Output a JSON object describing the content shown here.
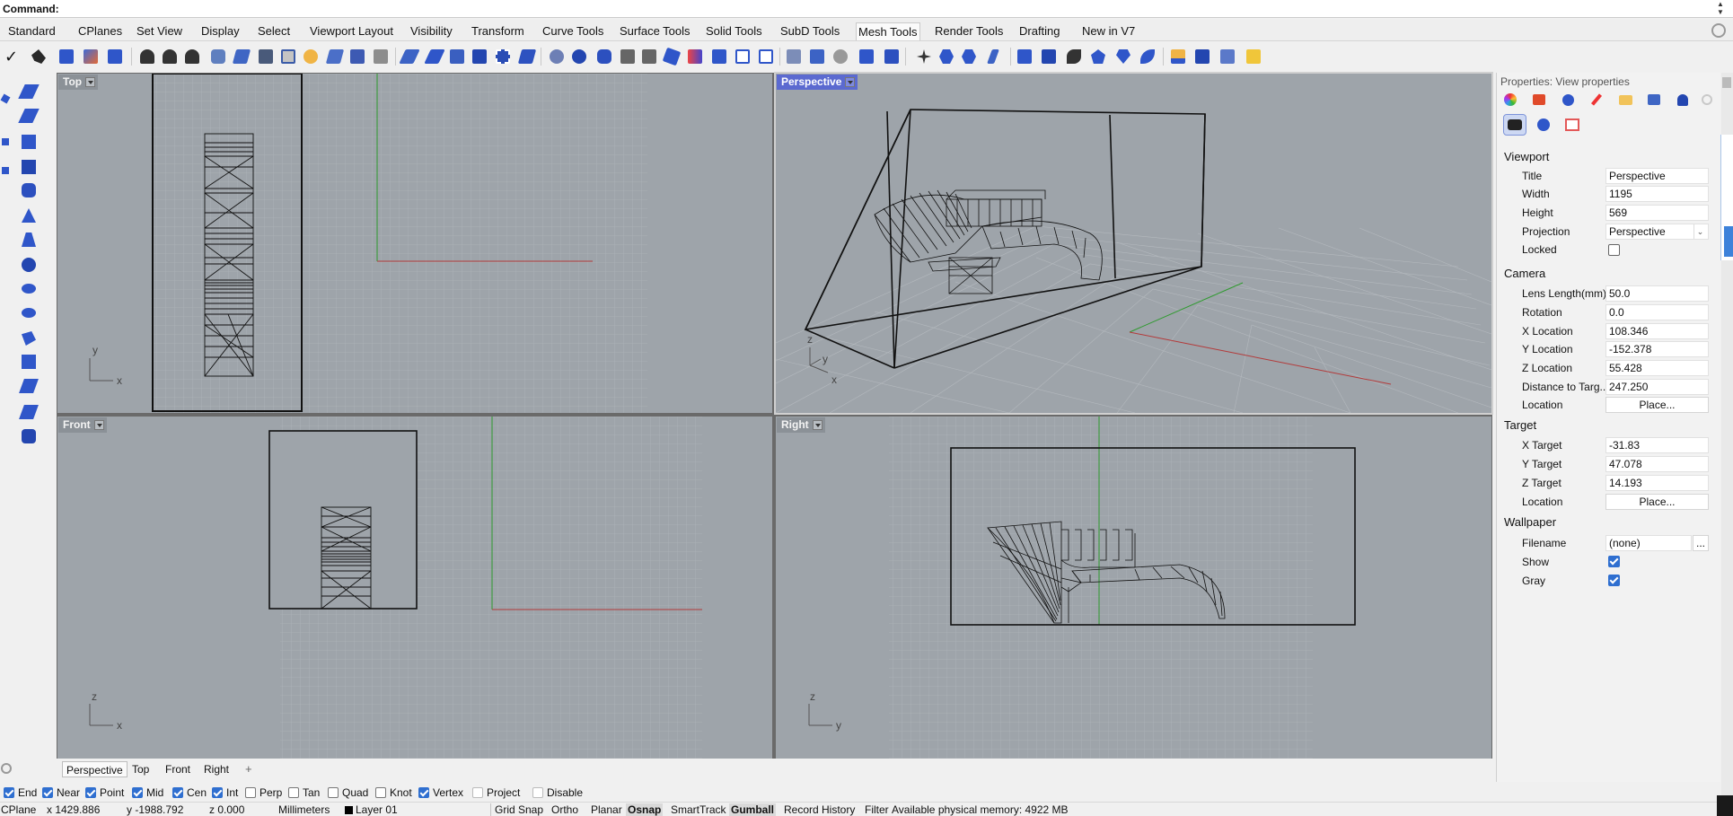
{
  "command": {
    "label": "Command:"
  },
  "tabs": [
    "Standard",
    "CPlanes",
    "Set View",
    "Display",
    "Select",
    "Viewport Layout",
    "Visibility",
    "Transform",
    "Curve Tools",
    "Surface Tools",
    "Solid Tools",
    "SubD Tools",
    "Mesh Tools",
    "Render Tools",
    "Drafting",
    "New in V7"
  ],
  "active_tab": "Mesh Tools",
  "viewports": {
    "top": {
      "title": "Top",
      "axis_a": "y",
      "axis_b": "x"
    },
    "perspective": {
      "title": "Perspective",
      "axis_z": "z",
      "axis_y": "y",
      "axis_x": "x"
    },
    "front": {
      "title": "Front",
      "axis_a": "z",
      "axis_b": "x"
    },
    "right": {
      "title": "Right",
      "axis_a": "z",
      "axis_b": "y"
    }
  },
  "viewport_tabs": [
    "Perspective",
    "Top",
    "Front",
    "Right"
  ],
  "viewport_tab_add": "+",
  "osnaps": [
    {
      "label": "End",
      "checked": true
    },
    {
      "label": "Near",
      "checked": true
    },
    {
      "label": "Point",
      "checked": true
    },
    {
      "label": "Mid",
      "checked": true
    },
    {
      "label": "Cen",
      "checked": true
    },
    {
      "label": "Int",
      "checked": true
    },
    {
      "label": "Perp",
      "checked": false
    },
    {
      "label": "Tan",
      "checked": false
    },
    {
      "label": "Quad",
      "checked": false
    },
    {
      "label": "Knot",
      "checked": false
    },
    {
      "label": "Vertex",
      "checked": true
    },
    {
      "label": "Project",
      "checked": false
    },
    {
      "label": "Disable",
      "checked": false
    }
  ],
  "status": {
    "cplane": "CPlane",
    "x": "x 1429.886",
    "y": "y -1988.792",
    "z": "z 0.000",
    "units": "Millimeters",
    "layer": "Layer 01",
    "grid_snap": "Grid Snap",
    "ortho": "Ortho",
    "planar": "Planar",
    "osnap": "Osnap",
    "smarttrack": "SmartTrack",
    "gumball": "Gumball",
    "record_history": "Record History",
    "filter": "Filter",
    "memory": "Available physical memory: 4922 MB"
  },
  "properties": {
    "title": "Properties: View properties",
    "sections": {
      "viewport": "Viewport",
      "camera": "Camera",
      "target": "Target",
      "wallpaper": "Wallpaper"
    },
    "viewport": {
      "title_label": "Title",
      "title_value": "Perspective",
      "width_label": "Width",
      "width_value": "1195",
      "height_label": "Height",
      "height_value": "569",
      "projection_label": "Projection",
      "projection_value": "Perspective",
      "locked_label": "Locked",
      "locked": false
    },
    "camera": {
      "lens_label": "Lens Length(mm)",
      "lens_value": "50.0",
      "rotation_label": "Rotation",
      "rotation_value": "0.0",
      "xloc_label": "X Location",
      "xloc_value": "108.346",
      "yloc_label": "Y Location",
      "yloc_value": "-152.378",
      "zloc_label": "Z Location",
      "zloc_value": "55.428",
      "dist_label": "Distance to Targ...",
      "dist_value": "247.250",
      "location_label": "Location",
      "place_button": "Place..."
    },
    "target": {
      "xt_label": "X Target",
      "xt_value": "-31.83",
      "yt_label": "Y Target",
      "yt_value": "47.078",
      "zt_label": "Z Target",
      "zt_value": "14.193",
      "location_label": "Location",
      "place_button": "Place..."
    },
    "wallpaper": {
      "filename_label": "Filename",
      "filename_value": "(none)",
      "browse": "...",
      "show_label": "Show",
      "show": true,
      "gray_label": "Gray",
      "gray": true
    }
  },
  "colors": {
    "viewport_bg": "#9ea4aa",
    "active_title": "#5b6ad0",
    "x_axis": "#b33a3a",
    "y_axis": "#2f9a2f",
    "grid": "#b4b9be"
  }
}
